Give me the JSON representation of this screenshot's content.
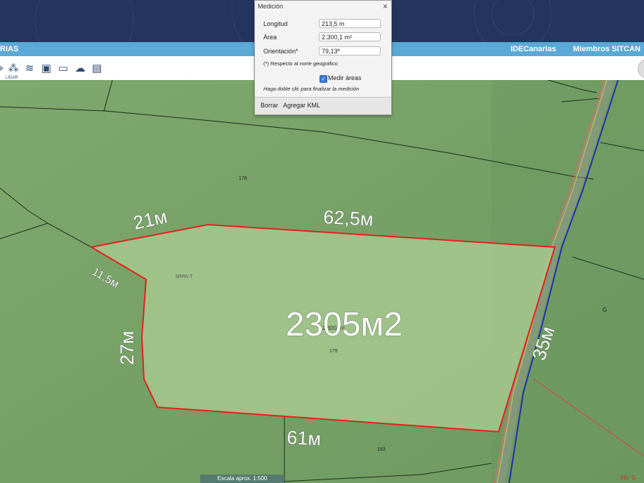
{
  "menubar": {
    "left_item": "RIAS",
    "right_item_1": "IDECanarias",
    "right_item_2": "Miembros SITCAN"
  },
  "toolbar": {
    "tools": [
      {
        "icon": "pin-icon",
        "glyph": "⌖"
      },
      {
        "icon": "lidar-icon",
        "glyph": "⁂",
        "sub": "LIDAR"
      },
      {
        "icon": "layers-icon",
        "glyph": "≋"
      },
      {
        "icon": "3d-icon",
        "glyph": "▣"
      },
      {
        "icon": "monitor-icon",
        "glyph": "▭"
      },
      {
        "icon": "cloud-icon",
        "glyph": "☁"
      },
      {
        "icon": "document-icon",
        "glyph": "▤"
      }
    ]
  },
  "dialog": {
    "title": "Medición",
    "close_label": "×",
    "fields": [
      {
        "label": "Longitud",
        "value": "213,5 m"
      },
      {
        "label": "Área",
        "value": "2.300,1 m²"
      },
      {
        "label": "Orientación*",
        "value": "79,13º"
      }
    ],
    "note_north": "(*) Respecto al norte geográfico",
    "checkbox_label": "Medir áreas",
    "checkbox_checked": true,
    "hint": "Haga doble clic para finalizar la medición",
    "footer": {
      "clear": "Borrar",
      "add_kml": "Agregar KML"
    }
  },
  "map": {
    "parcel_labels": {
      "p178": "178",
      "p179": "179",
      "p183": "183",
      "ref": "5RPA-T",
      "area_small": "2.300 m²",
      "circle_mark": "G"
    },
    "annotations": {
      "area": "2305м2",
      "side_top_left": "21м",
      "side_top": "62,5м",
      "side_left_upper": "11,5м",
      "side_left": "27м",
      "side_right": "35м",
      "side_bottom": "61м"
    },
    "scale": "Escala aprox. 1:500",
    "copyright": "©D. G"
  },
  "colors": {
    "header": "#23355f",
    "menubar": "#5aa9d6",
    "parcel_line": "#e61e1e",
    "terrain": "#7aa36a"
  }
}
